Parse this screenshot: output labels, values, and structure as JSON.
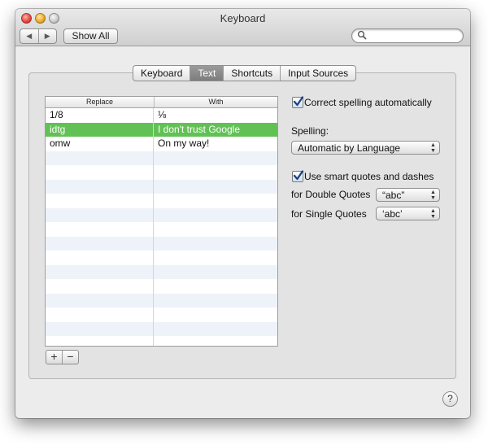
{
  "window": {
    "title": "Keyboard"
  },
  "toolbar": {
    "back_label": "◀",
    "forward_label": "▶",
    "show_all_label": "Show All",
    "search_placeholder": "",
    "search_value": ""
  },
  "tabs": [
    {
      "label": "Keyboard",
      "active": false
    },
    {
      "label": "Text",
      "active": true
    },
    {
      "label": "Shortcuts",
      "active": false
    },
    {
      "label": "Input Sources",
      "active": false
    }
  ],
  "table": {
    "columns": [
      "Replace",
      "With"
    ],
    "rows": [
      {
        "replace": "1/8",
        "with": "⅛",
        "selected": false
      },
      {
        "replace": "idtg",
        "with": "I don't trust Google",
        "selected": true
      },
      {
        "replace": "omw",
        "with": "On my way!",
        "selected": false
      }
    ],
    "add_label": "+",
    "remove_label": "−"
  },
  "options": {
    "correct_spelling_label": "Correct spelling automatically",
    "correct_spelling_checked": true,
    "spelling_label": "Spelling:",
    "spelling_value": "Automatic by Language",
    "smart_quotes_label": "Use smart quotes and dashes",
    "smart_quotes_checked": true,
    "double_quotes_label": "for Double Quotes",
    "double_quotes_value": "“abc”",
    "single_quotes_label": "for Single Quotes",
    "single_quotes_value": "‘abc’"
  },
  "help_label": "?",
  "colors": {
    "selection": "#62c155",
    "row_alt": "#eef3fa",
    "checkbox_check": "#1c3f7a"
  }
}
